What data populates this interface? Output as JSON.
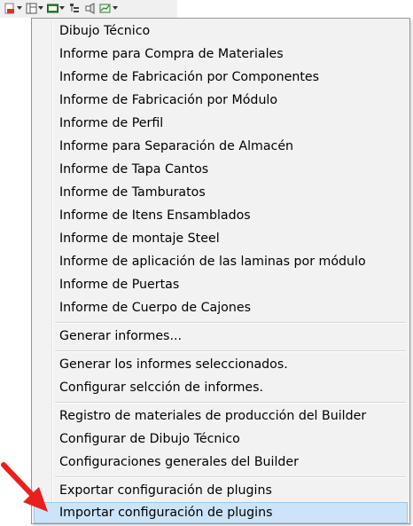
{
  "toolbar": {
    "buttons": [
      {
        "icon": "report-icon"
      },
      {
        "icon": "layout-icon"
      },
      {
        "icon": "cnc-icon"
      },
      {
        "icon": "tree-icon"
      },
      {
        "icon": "plugin-icon"
      },
      {
        "icon": "chart-icon"
      }
    ]
  },
  "menu": {
    "groups": [
      {
        "items": [
          "Dibujo Técnico",
          "Informe para Compra de Materiales",
          "Informe de Fabricación por Componentes",
          "Informe de Fabricación por Módulo",
          "Informe de Perfil",
          "Informe para Separación de Almacén",
          "Informe de Tapa Cantos",
          "Informe de Tamburatos",
          "Informe de Itens Ensamblados",
          "Informe de montaje Steel",
          "Informe de aplicación de las laminas por módulo",
          "Informe de Puertas",
          "Informe de Cuerpo de Cajones"
        ]
      },
      {
        "items": [
          "Generar informes..."
        ]
      },
      {
        "items": [
          "Generar los informes seleccionados.",
          "Configurar selcción de informes."
        ]
      },
      {
        "items": [
          "Registro de materiales de producción del Builder",
          "Configurar de Dibujo Técnico",
          "Configuraciones generales del Builder"
        ]
      },
      {
        "items": [
          "Exportar configuración de plugins",
          "Importar configuración de plugins"
        ]
      }
    ],
    "highlighted_item": "Importar configuración de plugins"
  },
  "annotation": {
    "arrow_color": "#e8201e"
  },
  "colors": {
    "menu_background": "#f2f2f2",
    "highlight_background": "#cce4f7",
    "highlight_border": "#99c9ef"
  }
}
